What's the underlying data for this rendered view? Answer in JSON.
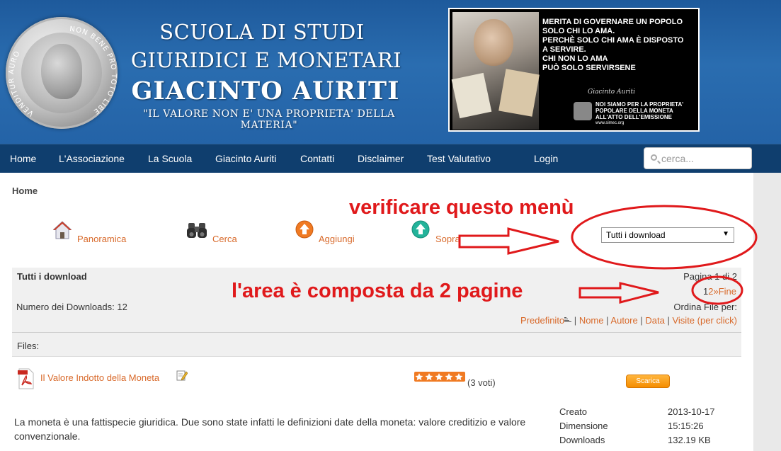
{
  "header": {
    "line1": "SCUOLA DI STUDI",
    "line2": "GIURIDICI E MONETARI",
    "line3": "GIACINTO AURITI",
    "tagline": "\"IL VALORE NON E' UNA PROPRIETA' DELLA MATERIA\"",
    "coin_text_left": "VENDITUR AURO",
    "coin_text_right": "NON BENE PRO TOTO LIBERTAS",
    "quote_lines": [
      "MERITA DI GOVERNARE UN POPOLO",
      "SOLO CHI LO AMA.",
      "PERCHÈ SOLO CHI AMA È DISPOSTO",
      "A SERVIRE.",
      "CHI NON LO AMA",
      "PUÒ SOLO  SERVIRSENE"
    ],
    "quote_signature": "Giacinto Auriti",
    "quote_small_lines": [
      "NOI SIAMO PER LA PROPRIETA'",
      "POPOLARE DELLA MONETA",
      "ALL'ATTO DELL'EMISSIONE"
    ],
    "quote_url": "www.simec.org"
  },
  "nav": {
    "items": [
      {
        "label": "Home"
      },
      {
        "label": "L'Associazione"
      },
      {
        "label": "La Scuola"
      },
      {
        "label": "Giacinto Auriti"
      },
      {
        "label": "Contatti"
      },
      {
        "label": "Disclaimer"
      },
      {
        "label": "Test Valutativo"
      },
      {
        "label": "Login"
      }
    ],
    "search_placeholder": "cerca..."
  },
  "breadcrumb": "Home",
  "toolbar": {
    "panoramica": "Panoramica",
    "cerca": "Cerca",
    "aggiungi": "Aggiungi",
    "sopra": "Sopra"
  },
  "category_select": {
    "selected": "Tutti i download"
  },
  "annotations": {
    "top": "verificare questo menù",
    "middle": "l'area è composta da 2 pagine",
    "color": "#e0191b"
  },
  "panel": {
    "title": "Tutti i download",
    "count_label": "Numero dei Downloads: 12",
    "page_info": "Pagina 1 di 2",
    "pager_current": "1",
    "pager_next_page": "2",
    "pager_next": "»",
    "pager_end": "Fine",
    "sort_label": "Ordina File per:",
    "sort_links": {
      "default": "Predefinito",
      "name": "Nome",
      "author": "Autore",
      "date": "Data",
      "visits": "Visite (per click)",
      "separator": "|"
    }
  },
  "files": {
    "header": "Files:",
    "items": [
      {
        "name": "Il Valore Indotto della Moneta",
        "rating": 5,
        "votes": "(3 voti)",
        "download_label": "Scarica",
        "description": "La moneta è una fattispecie giuridica. Due sono state infatti le definizioni date della moneta: valore creditizio e valore convenzionale.",
        "meta": [
          {
            "key": "Creato",
            "value": "2013-10-17"
          },
          {
            "key": "Dimensione",
            "value": "15:15:26"
          },
          {
            "key": "Downloads",
            "value": "132.19 KB"
          }
        ]
      }
    ]
  },
  "colors": {
    "header_blue": "#2463a7",
    "nav_bg": "#0f3e6e",
    "link_orange": "#d8692a",
    "button_orange": "#f58d00"
  }
}
